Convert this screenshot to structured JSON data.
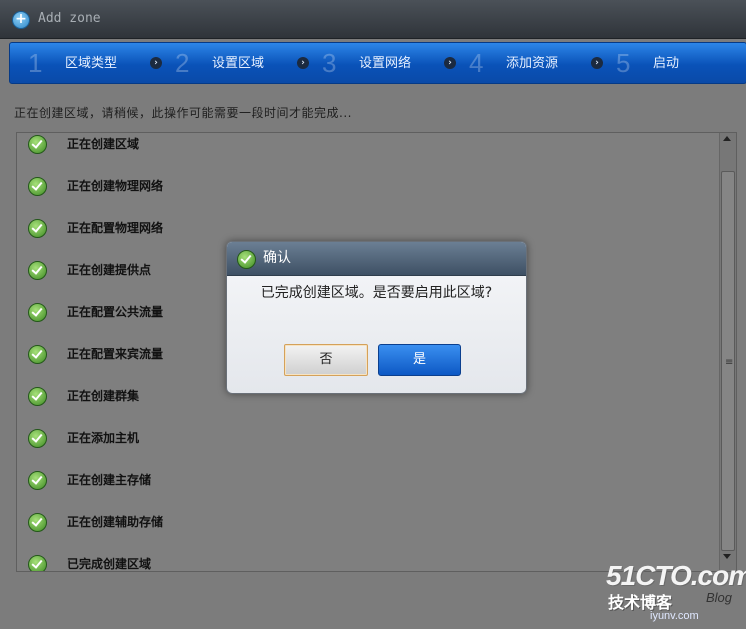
{
  "window": {
    "title": "Add zone",
    "icon": "plus-circle-icon"
  },
  "wizard": {
    "steps": [
      {
        "number": "1",
        "label": "区域类型"
      },
      {
        "number": "2",
        "label": "设置区域"
      },
      {
        "number": "3",
        "label": "设置网络"
      },
      {
        "number": "4",
        "label": "添加资源"
      },
      {
        "number": "5",
        "label": "启动"
      }
    ],
    "separator_icon": "chevron-right-icon"
  },
  "status_text": "正在创建区域，请稍候，此操作可能需要一段时间才能完成...",
  "tasks": [
    {
      "label": "正在创建区域",
      "icon": "check-circle-icon"
    },
    {
      "label": "正在创建物理网络",
      "icon": "check-circle-icon"
    },
    {
      "label": "正在配置物理网络",
      "icon": "check-circle-icon"
    },
    {
      "label": "正在创建提供点",
      "icon": "check-circle-icon"
    },
    {
      "label": "正在配置公共流量",
      "icon": "check-circle-icon"
    },
    {
      "label": "正在配置来宾流量",
      "icon": "check-circle-icon"
    },
    {
      "label": "正在创建群集",
      "icon": "check-circle-icon"
    },
    {
      "label": "正在添加主机",
      "icon": "check-circle-icon"
    },
    {
      "label": "正在创建主存储",
      "icon": "check-circle-icon"
    },
    {
      "label": "正在创建辅助存储",
      "icon": "check-circle-icon"
    },
    {
      "label": "已完成创建区域",
      "icon": "check-circle-icon"
    }
  ],
  "dialog": {
    "title": "确认",
    "icon": "check-circle-icon",
    "message": "已完成创建区域。是否要启用此区域?",
    "no_label": "否",
    "yes_label": "是"
  },
  "watermark": {
    "logo": "51CTO.com",
    "subtitle": "技术博客",
    "blog": "Blog",
    "url": "iyunv.com"
  },
  "colors": {
    "accent": "#0a52b8",
    "check_green": "#3d8a22",
    "dialog_header": "#4a5d72"
  }
}
